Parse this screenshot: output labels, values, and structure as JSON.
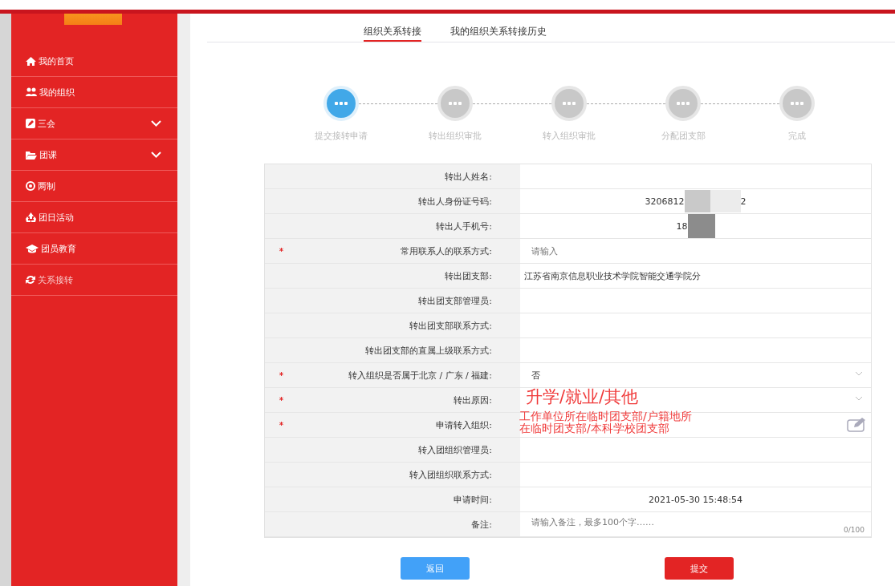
{
  "sidebar": {
    "items": [
      {
        "label": "我的首页",
        "selected": false
      },
      {
        "label": "我的组织",
        "selected": false
      },
      {
        "label": "三会",
        "expanded": false,
        "selected": false
      },
      {
        "label": "团课",
        "expanded": false,
        "selected": false
      },
      {
        "label": "两制",
        "selected": false
      },
      {
        "label": "团日活动",
        "selected": false
      },
      {
        "label": "团员教育",
        "selected": false
      },
      {
        "label": "关系接转",
        "selected": true
      }
    ]
  },
  "tabs": [
    {
      "label": "组织关系转接",
      "selected": true
    },
    {
      "label": "我的组织关系转接历史",
      "selected": false
    }
  ],
  "steps": [
    {
      "label": "提交接转申请",
      "active": true
    },
    {
      "label": "转出组织审批",
      "active": false
    },
    {
      "label": "转入组织审批",
      "active": false
    },
    {
      "label": "分配团支部",
      "active": false
    },
    {
      "label": "完成",
      "active": false
    }
  ],
  "form": {
    "rows": [
      {
        "label": "转出人姓名:",
        "kind": "text",
        "required": false
      },
      {
        "label": "转出人身份证号码:",
        "kind": "redacted",
        "required": false,
        "value": "3206812",
        "value_end": "2"
      },
      {
        "label": "转出人手机号:",
        "kind": "redacted",
        "required": false,
        "value": "18"
      },
      {
        "label": "常用联系人的联系方式:",
        "kind": "input",
        "required": true,
        "placeholder": "请输入"
      },
      {
        "label": "转出团支部:",
        "kind": "plain",
        "required": false,
        "value": "江苏省南京信息职业技术学院智能交通学院分"
      },
      {
        "label": "转出团支部管理员:",
        "kind": "text",
        "required": false
      },
      {
        "label": "转出团支部联系方式:",
        "kind": "text",
        "required": false
      },
      {
        "label": "转出团支部的直属上级联系方式:",
        "kind": "text",
        "required": false
      },
      {
        "label": "转入组织是否属于北京 / 广东 / 福建:",
        "kind": "select",
        "required": true,
        "value": "否"
      },
      {
        "label": "转出原因:",
        "kind": "select",
        "required": true
      },
      {
        "label": "申请转入组织:",
        "kind": "picker",
        "required": true
      },
      {
        "label": "转入团组织管理员:",
        "kind": "text",
        "required": false
      },
      {
        "label": "转入团组织联系方式:",
        "kind": "text",
        "required": false
      },
      {
        "label": "申请时间:",
        "kind": "text",
        "required": false,
        "value": "2021-05-30 15:48:54"
      },
      {
        "label": "备注:",
        "kind": "textarea",
        "required": false,
        "placeholder": "请输入备注，最多100个字……",
        "counter": "0/100"
      }
    ],
    "annotations": [
      "升学/就业/其他",
      "工作单位所在临时团支部/户籍地所在临时团支部/本科学校团支部"
    ]
  },
  "buttons": [
    {
      "label": "返回",
      "kind": "secondary"
    },
    {
      "label": "提交",
      "kind": "primary"
    }
  ]
}
